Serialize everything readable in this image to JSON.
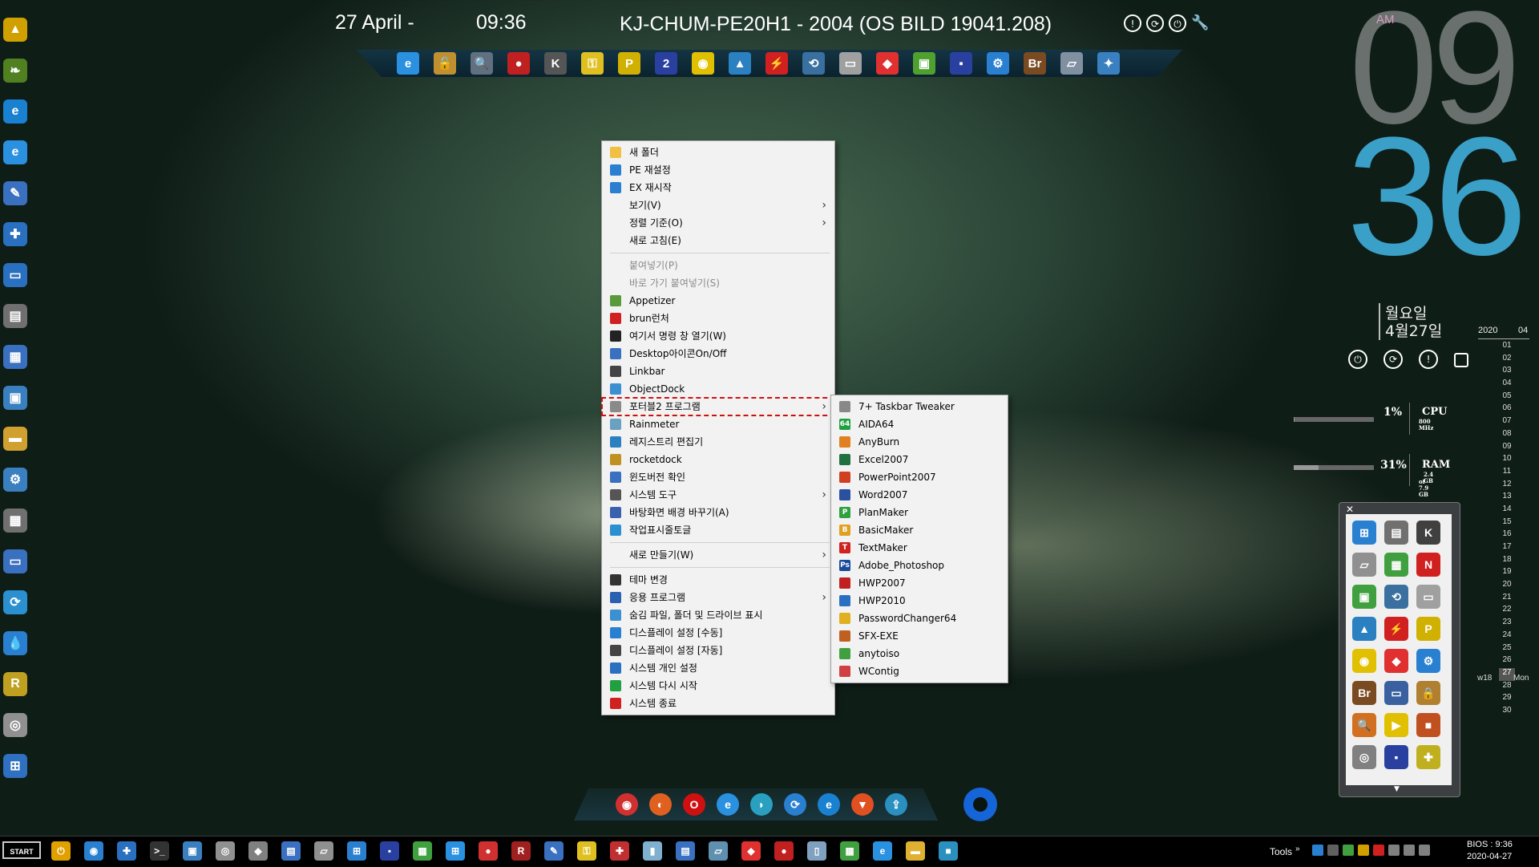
{
  "topbar": {
    "date": "27 April -",
    "time": "09:36",
    "title": "KJ-CHUM-PE20H1 - 2004 (OS BILD 19041.208)"
  },
  "clock": {
    "ampm": "AM",
    "hour": "09",
    "minute": "36",
    "weekday": "월요일",
    "date": "4월27일"
  },
  "calendar": {
    "year": "2020",
    "month": "04",
    "days": [
      "01",
      "02",
      "03",
      "04",
      "05",
      "06",
      "07",
      "08",
      "09",
      "10",
      "11",
      "12",
      "13",
      "14",
      "15",
      "16",
      "17",
      "18",
      "19",
      "20",
      "21",
      "22",
      "23",
      "24",
      "25",
      "26",
      "27",
      "28",
      "29",
      "30"
    ],
    "today": "27",
    "week": "w18",
    "weekday": "Mon"
  },
  "meters": {
    "cpu": {
      "percent": "1%",
      "label": "CPU",
      "sub": "800 MHz",
      "fill": 0.01
    },
    "ram": {
      "percent": "31%",
      "label": "RAM",
      "sub1": "2.4 GB",
      "sub2": "of 7.9 GB",
      "fill": 0.31
    }
  },
  "context_menu": [
    {
      "label": "새 폴더",
      "icon": "folder-icon",
      "color": "#f0c040"
    },
    {
      "label": "PE 재설정",
      "icon": "refresh-icon",
      "color": "#2a7fd0"
    },
    {
      "label": "EX 재시작",
      "icon": "refresh-icon",
      "color": "#2a7fd0"
    },
    {
      "label": "보기(V)",
      "submenu": true
    },
    {
      "label": "정렬 기준(O)",
      "submenu": true
    },
    {
      "label": "새로 고침(E)"
    },
    {
      "separator": true
    },
    {
      "label": "붙여넣기(P)",
      "disabled": true
    },
    {
      "label": "바로 가기 붙여넣기(S)",
      "disabled": true
    },
    {
      "label": "Appetizer",
      "icon": "appetizer-icon",
      "color": "#5a9a3a"
    },
    {
      "label": "brun런처",
      "icon": "brun-icon",
      "color": "#d02020"
    },
    {
      "label": "여기서 명령 창 열기(W)",
      "icon": "cmd-icon",
      "color": "#222222"
    },
    {
      "label": "Desktop아이콘On/Off",
      "icon": "desktop-icon",
      "color": "#3a70c0"
    },
    {
      "label": "Linkbar",
      "icon": "linkbar-icon",
      "color": "#444444"
    },
    {
      "label": "ObjectDock",
      "icon": "objectdock-icon",
      "color": "#3a90d0"
    },
    {
      "label": "포터블2 프로그램",
      "icon": "portable-icon",
      "color": "#8a8a8a",
      "submenu": true,
      "highlighted": true
    },
    {
      "label": "Rainmeter",
      "icon": "rainmeter-icon",
      "color": "#6aa0c0"
    },
    {
      "label": "레지스트리 편집기",
      "icon": "registry-icon",
      "color": "#2a80c0"
    },
    {
      "label": "rocketdock",
      "icon": "rocketdock-icon",
      "color": "#c09020"
    },
    {
      "label": "윈도버전 확인",
      "icon": "winver-icon",
      "color": "#3a70c0"
    },
    {
      "label": "시스템 도구",
      "icon": "system-tools-icon",
      "color": "#555555",
      "submenu": true
    },
    {
      "label": "바탕화면 배경 바꾸기(A)",
      "icon": "wallpaper-icon",
      "color": "#3a60b0"
    },
    {
      "label": "작업표시줄토글",
      "icon": "taskbar-icon",
      "color": "#2a90d0"
    },
    {
      "separator": true
    },
    {
      "label": "새로 만들기(W)",
      "submenu": true
    },
    {
      "separator": true
    },
    {
      "label": "테마 변경",
      "icon": "theme-icon",
      "color": "#333333"
    },
    {
      "label": "응용 프로그램",
      "icon": "apps-icon",
      "color": "#2a60b0",
      "submenu": true
    },
    {
      "label": "숨김 파일, 폴더 및 드라이브 표시",
      "icon": "hidden-icon",
      "color": "#3a90d0"
    },
    {
      "label": "디스플레이 설정 [수동]",
      "icon": "display-icon",
      "color": "#2a80d0"
    },
    {
      "label": "디스플레이 설정 [자동]",
      "icon": "display-icon",
      "color": "#444444"
    },
    {
      "label": "시스템 개인 설정",
      "icon": "personalize-icon",
      "color": "#2a70c0"
    },
    {
      "label": "시스템 다시 시작",
      "icon": "restart-icon",
      "color": "#20a040"
    },
    {
      "label": "시스템 종료",
      "icon": "shutdown-icon",
      "color": "#d02020"
    }
  ],
  "submenu": [
    {
      "label": "7+ Taskbar Tweaker",
      "icon": "tweaker-icon",
      "color": "#888888"
    },
    {
      "label": "AIDA64",
      "icon": "aida-icon",
      "color": "#20a040",
      "glyph": "64"
    },
    {
      "label": "AnyBurn",
      "icon": "anyburn-icon",
      "color": "#e08020"
    },
    {
      "label": "Excel2007",
      "icon": "excel-icon",
      "color": "#207040"
    },
    {
      "label": "PowerPoint2007",
      "icon": "powerpoint-icon",
      "color": "#d04020"
    },
    {
      "label": "Word2007",
      "icon": "word-icon",
      "color": "#2a50a0"
    },
    {
      "label": "PlanMaker",
      "icon": "planmaker-icon",
      "color": "#30a040",
      "glyph": "P"
    },
    {
      "label": "BasicMaker",
      "icon": "basicmaker-icon",
      "color": "#e0a020",
      "glyph": "B"
    },
    {
      "label": "TextMaker",
      "icon": "textmaker-icon",
      "color": "#d02020",
      "glyph": "T"
    },
    {
      "label": "Adobe_Photoshop",
      "icon": "photoshop-icon",
      "color": "#1a4a9a",
      "glyph": "Ps"
    },
    {
      "label": "HWP2007",
      "icon": "hwp-icon",
      "color": "#c02020"
    },
    {
      "label": "HWP2010",
      "icon": "hwp-icon",
      "color": "#2a70c0"
    },
    {
      "label": "PasswordChanger64",
      "icon": "key-icon",
      "color": "#e0b020"
    },
    {
      "label": "SFX-EXE",
      "icon": "sfx-icon",
      "color": "#c06020"
    },
    {
      "label": "anytoiso",
      "icon": "anytoiso-icon",
      "color": "#40a040"
    },
    {
      "label": "WContig",
      "icon": "wcontig-icon",
      "color": "#d04040"
    }
  ],
  "topdock_icons": [
    {
      "icon": "ie-icon",
      "color": "#2a90e0",
      "glyph": "e"
    },
    {
      "icon": "unlock-icon",
      "color": "#c09030",
      "glyph": "🔓"
    },
    {
      "icon": "search-icon",
      "color": "#607080",
      "glyph": "🔍"
    },
    {
      "icon": "santa-icon",
      "color": "#c02020",
      "glyph": "●"
    },
    {
      "icon": "k-icon",
      "color": "#555555",
      "glyph": "K"
    },
    {
      "icon": "key-icon",
      "color": "#e0c020",
      "glyph": "⚿"
    },
    {
      "icon": "pdf-icon",
      "color": "#d0b000",
      "glyph": "P"
    },
    {
      "icon": "two-icon",
      "color": "#2a40a0",
      "glyph": "2"
    },
    {
      "icon": "disc-icon",
      "color": "#e0c000",
      "glyph": "◉"
    },
    {
      "icon": "triangle-icon",
      "color": "#2a80c0",
      "glyph": "▲"
    },
    {
      "icon": "flash-icon",
      "color": "#d02020",
      "glyph": "⚡"
    },
    {
      "icon": "backup-icon",
      "color": "#3a70a0",
      "glyph": "⟲"
    },
    {
      "icon": "drive-icon",
      "color": "#a0a0a0",
      "glyph": "▭"
    },
    {
      "icon": "anydesk-icon",
      "color": "#e03030",
      "glyph": "◆"
    },
    {
      "icon": "hdd-icon",
      "color": "#50a030",
      "glyph": "▣"
    },
    {
      "icon": "floppy-icon",
      "color": "#2a40a0",
      "glyph": "▪"
    },
    {
      "icon": "gears-icon",
      "color": "#2a80d0",
      "glyph": "⚙"
    },
    {
      "icon": "bridge-icon",
      "color": "#7a4a20",
      "glyph": "Br"
    },
    {
      "icon": "scanner-icon",
      "color": "#8090a0",
      "glyph": "▱"
    },
    {
      "icon": "tools-icon",
      "color": "#3a80c0",
      "glyph": "✦"
    }
  ],
  "left_icons": [
    {
      "icon": "warning-icon",
      "color": "#d0a000",
      "glyph": "▲"
    },
    {
      "icon": "leaf-icon",
      "color": "#508020",
      "glyph": "❧"
    },
    {
      "icon": "edge-icon",
      "color": "#1a80d0",
      "glyph": "e"
    },
    {
      "icon": "ie-icon",
      "color": "#2a90e0",
      "glyph": "e"
    },
    {
      "icon": "tools-icon",
      "color": "#3a70c0",
      "glyph": "✎"
    },
    {
      "icon": "puzzle-icon",
      "color": "#2a70c0",
      "glyph": "✚"
    },
    {
      "icon": "monitor-icon",
      "color": "#2a70c0",
      "glyph": "▭"
    },
    {
      "icon": "printer-icon",
      "color": "#707070",
      "glyph": "▤"
    },
    {
      "icon": "network-icon",
      "color": "#3a70c0",
      "glyph": "▦"
    },
    {
      "icon": "computer-icon",
      "color": "#3a80c0",
      "glyph": "▣"
    },
    {
      "icon": "folder-icon",
      "color": "#d0a030",
      "glyph": "▬"
    },
    {
      "icon": "gear-icon",
      "color": "#3a80c0",
      "glyph": "⚙"
    },
    {
      "icon": "device-icon",
      "color": "#707070",
      "glyph": "▩"
    },
    {
      "icon": "display-icon",
      "color": "#3a70c0",
      "glyph": "▭"
    },
    {
      "icon": "refresh-icon",
      "color": "#2a90d0",
      "glyph": "⟳"
    },
    {
      "icon": "drop-icon",
      "color": "#2a80d0",
      "glyph": "💧"
    },
    {
      "icon": "rocket-icon",
      "color": "#c0a020",
      "glyph": "R"
    },
    {
      "icon": "cd-icon",
      "color": "#909090",
      "glyph": "◎"
    },
    {
      "icon": "windows-icon",
      "color": "#3070c0",
      "glyph": "⊞"
    }
  ],
  "right_dock_icons": [
    {
      "icon": "windows-flag-icon",
      "color": "#2a80d0",
      "glyph": "⊞"
    },
    {
      "icon": "hdd-stack-icon",
      "color": "#707070",
      "glyph": "▤"
    },
    {
      "icon": "k-icon",
      "color": "#404040",
      "glyph": "K"
    },
    {
      "icon": "scanner-icon",
      "color": "#909090",
      "glyph": "▱"
    },
    {
      "icon": "chart-icon",
      "color": "#40a040",
      "glyph": "▦"
    },
    {
      "icon": "nt-icon",
      "color": "#d02020",
      "glyph": "N"
    },
    {
      "icon": "hdd-icon",
      "color": "#40a040",
      "glyph": "▣"
    },
    {
      "icon": "backup-icon",
      "color": "#3a70a0",
      "glyph": "⟲"
    },
    {
      "icon": "drive-icon",
      "color": "#a0a0a0",
      "glyph": "▭"
    },
    {
      "icon": "triangle-icon",
      "color": "#2a80c0",
      "glyph": "▲"
    },
    {
      "icon": "flash-icon",
      "color": "#d02020",
      "glyph": "⚡"
    },
    {
      "icon": "pdf-icon",
      "color": "#d0b000",
      "glyph": "P"
    },
    {
      "icon": "disc-icon",
      "color": "#e0c000",
      "glyph": "◉"
    },
    {
      "icon": "anydesk-icon",
      "color": "#e03030",
      "glyph": "◆"
    },
    {
      "icon": "gears-icon",
      "color": "#2a80d0",
      "glyph": "⚙"
    },
    {
      "icon": "bridge-icon",
      "color": "#7a4a20",
      "glyph": "Br"
    },
    {
      "icon": "monitor-icon",
      "color": "#3a60a0",
      "glyph": "▭"
    },
    {
      "icon": "lock-icon",
      "color": "#b08030",
      "glyph": "🔒"
    },
    {
      "icon": "magnifier-icon",
      "color": "#d07020",
      "glyph": "🔍"
    },
    {
      "icon": "play-icon",
      "color": "#e0c000",
      "glyph": "▶"
    },
    {
      "icon": "box-icon",
      "color": "#c05020",
      "glyph": "■"
    },
    {
      "icon": "dvd-icon",
      "color": "#808080",
      "glyph": "◎"
    },
    {
      "icon": "floppy-icon",
      "color": "#2a40a0",
      "glyph": "▪"
    },
    {
      "icon": "puzzle-icon",
      "color": "#c0b020",
      "glyph": "✚"
    }
  ],
  "bottom_dock_icons": [
    {
      "icon": "chrome-icon",
      "color": "#d03030",
      "glyph": "◉"
    },
    {
      "icon": "firefox-icon",
      "color": "#e06020",
      "glyph": "◐"
    },
    {
      "icon": "opera-icon",
      "color": "#d01010",
      "glyph": "O"
    },
    {
      "icon": "ie-icon",
      "color": "#2a90e0",
      "glyph": "e"
    },
    {
      "icon": "steam-icon",
      "color": "#2aa0c0",
      "glyph": "◗"
    },
    {
      "icon": "refresh-icon",
      "color": "#2a80d0",
      "glyph": "⟳"
    },
    {
      "icon": "edge-icon",
      "color": "#1a80d0",
      "glyph": "e"
    },
    {
      "icon": "brave-icon",
      "color": "#e05020",
      "glyph": "▼"
    },
    {
      "icon": "upload-icon",
      "color": "#2a90c0",
      "glyph": "⇪"
    }
  ],
  "taskbar": {
    "start_label": "START",
    "icons": [
      {
        "icon": "power-icon",
        "color": "#e0a000",
        "glyph": "⏻"
      },
      {
        "icon": "app-icon",
        "color": "#2a80d0",
        "glyph": "◉"
      },
      {
        "icon": "puzzle-icon",
        "color": "#2a70c0",
        "glyph": "✚"
      },
      {
        "icon": "cmd-icon",
        "color": "#333333",
        "glyph": ">_"
      },
      {
        "icon": "computer-icon",
        "color": "#3a80c0",
        "glyph": "▣"
      },
      {
        "icon": "cd-icon",
        "color": "#909090",
        "glyph": "◎"
      },
      {
        "icon": "tag-icon",
        "color": "#808080",
        "glyph": "◆"
      },
      {
        "icon": "printer-icon",
        "color": "#3a70c0",
        "glyph": "▤"
      },
      {
        "icon": "scanner-icon",
        "color": "#909090",
        "glyph": "▱"
      },
      {
        "icon": "windows-flag-icon",
        "color": "#2a80d0",
        "glyph": "⊞"
      },
      {
        "icon": "floppy-icon",
        "color": "#2a40a0",
        "glyph": "▪"
      },
      {
        "icon": "network-icon",
        "color": "#40a040",
        "glyph": "▦"
      },
      {
        "icon": "windows-icon",
        "color": "#2a90e0",
        "glyph": "⊞"
      },
      {
        "icon": "ball-icon",
        "color": "#d03030",
        "glyph": "●"
      },
      {
        "icon": "r-icon",
        "color": "#a02020",
        "glyph": "R"
      },
      {
        "icon": "tools-icon",
        "color": "#3a70c0",
        "glyph": "✎"
      },
      {
        "icon": "key-icon",
        "color": "#e0c020",
        "glyph": "⚿"
      },
      {
        "icon": "robot-icon",
        "color": "#c03030",
        "glyph": "✚"
      },
      {
        "icon": "bottle-icon",
        "color": "#80b0d0",
        "glyph": "▮"
      },
      {
        "icon": "keyboard-icon",
        "color": "#3a70c0",
        "glyph": "▤"
      },
      {
        "icon": "drive-icon",
        "color": "#6090b0",
        "glyph": "▱"
      },
      {
        "icon": "anydesk-icon",
        "color": "#e03030",
        "glyph": "◆"
      },
      {
        "icon": "santa-icon",
        "color": "#c02020",
        "glyph": "●"
      },
      {
        "icon": "notepad-icon",
        "color": "#80a0c0",
        "glyph": "▯"
      },
      {
        "icon": "chart-icon",
        "color": "#40a040",
        "glyph": "▦"
      },
      {
        "icon": "ie-icon",
        "color": "#2a90e0",
        "glyph": "e"
      },
      {
        "icon": "folder-icon",
        "color": "#e0b030",
        "glyph": "▬"
      },
      {
        "icon": "box-icon",
        "color": "#2a90c0",
        "glyph": "■"
      }
    ],
    "tools_label": "Tools",
    "tools_chevron": "»",
    "tray_icons": [
      {
        "icon": "drop-icon",
        "color": "#2a80d0"
      },
      {
        "icon": "usb-icon",
        "color": "#606060"
      },
      {
        "icon": "chart-icon",
        "color": "#40a040"
      },
      {
        "icon": "warning-icon",
        "color": "#d0a000"
      },
      {
        "icon": "nt-icon",
        "color": "#d02020"
      },
      {
        "icon": "signal-icon",
        "color": "#808080"
      },
      {
        "icon": "monitor-icon",
        "color": "#808080"
      },
      {
        "icon": "speaker-icon",
        "color": "#808080"
      },
      {
        "icon": "keyboard-letter-icon",
        "color": "#000000"
      }
    ],
    "clock_line1": "BIOS : 9:36",
    "clock_line2": "2020-04-27"
  }
}
